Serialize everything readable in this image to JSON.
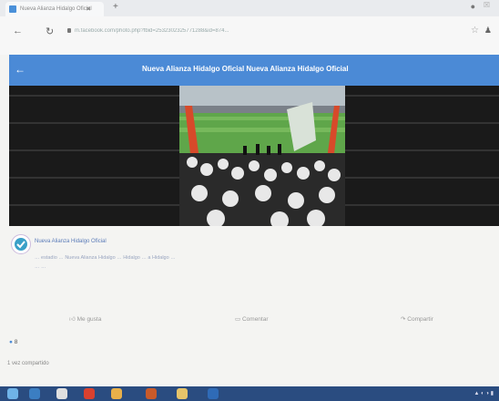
{
  "browser": {
    "tab_title": "Nueva Alianza Hidalgo Oficial",
    "url": "m.facebook.com/photo.php?fbid=2532302325771288&id=874...",
    "colors": {
      "tab_bg": "#e9ebee",
      "bar_bg": "#f7f7f7"
    }
  },
  "header": {
    "title": "Nueva Alianza Hidalgo Oficial    Nueva Alianza Hidalgo Oficial",
    "color": "#4b8ad6"
  },
  "post": {
    "author": "Nueva Alianza Hidalgo Oficial",
    "text_line1": "… estadio … Nueva Alianza Hidalgo … Hidalgo … a Hidalgo …",
    "text_line2": "… …"
  },
  "actions": {
    "like": "Me gusta",
    "comment": "Comentar",
    "share": "Compartir"
  },
  "reactions": {
    "count": "8"
  },
  "shares": "1 vez compartido",
  "icons": {
    "back": "back-arrow-icon",
    "reload": "reload-icon",
    "lock": "lock-icon",
    "star": "bookmark-star-icon",
    "user": "user-icon",
    "like": "thumbs-up-icon",
    "comment": "comment-icon",
    "share": "share-icon"
  }
}
